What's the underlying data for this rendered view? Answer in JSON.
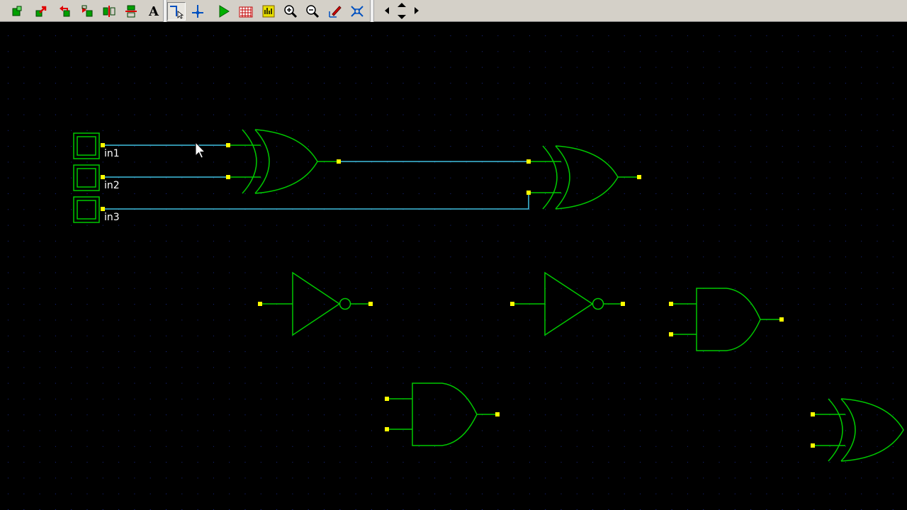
{
  "app": {
    "toolbar": {
      "tools": [
        {
          "name": "new-component",
          "icon": "green-block-icon"
        },
        {
          "name": "move",
          "icon": "red-arrow-icon"
        },
        {
          "name": "rotate-left",
          "icon": "rotate-left-icon"
        },
        {
          "name": "rotate-right",
          "icon": "rotate-right-icon"
        },
        {
          "name": "flip-horizontal",
          "icon": "flip-horizontal-icon"
        },
        {
          "name": "flip-vertical",
          "icon": "flip-vertical-icon"
        },
        {
          "name": "text",
          "label": "A",
          "icon": "text-icon"
        },
        {
          "name": "wire",
          "icon": "wire-tool-icon",
          "pressed": true
        },
        {
          "name": "junction",
          "icon": "junction-icon"
        },
        {
          "name": "simulate",
          "icon": "play-icon"
        },
        {
          "name": "timing",
          "icon": "timing-icon"
        },
        {
          "name": "probe",
          "icon": "probe-icon"
        },
        {
          "name": "zoom-in",
          "icon": "zoom-in-icon"
        },
        {
          "name": "zoom-out",
          "icon": "zoom-out-icon"
        },
        {
          "name": "edit-properties",
          "icon": "edit-pencil-icon"
        },
        {
          "name": "netlist",
          "icon": "netlist-icon"
        }
      ],
      "scroll_arrows": [
        "left",
        "up",
        "down",
        "right"
      ]
    },
    "colors": {
      "background": "#000000",
      "grid_dot": "#1a2a8a",
      "gate": "#00c800",
      "wire": "#40c0e0",
      "pin": "#ffff00",
      "label": "#ffffff"
    },
    "inputs": [
      {
        "label": "in1"
      },
      {
        "label": "in2"
      },
      {
        "label": "in3"
      }
    ]
  }
}
